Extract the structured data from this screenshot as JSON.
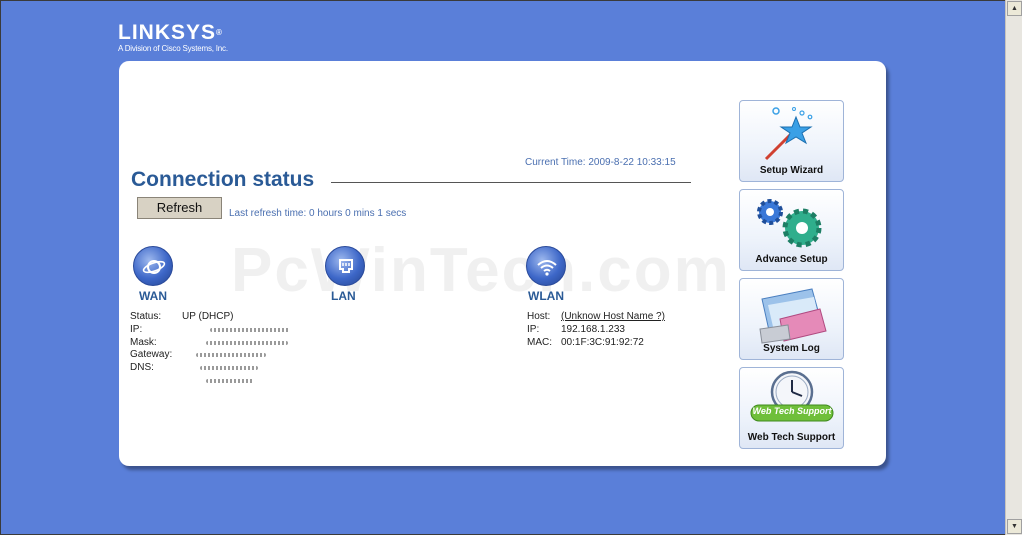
{
  "brand": {
    "name": "LINKSYS",
    "reg": "®",
    "subtitle": "A Division of Cisco Systems, Inc."
  },
  "header": {
    "current_time_label": "Current Time: 2009-8-22 10:33:15",
    "title": "Connection status"
  },
  "refresh": {
    "button_label": "Refresh",
    "last_refresh": "Last refresh time: 0 hours 0 mins 1 secs"
  },
  "watermark": "PcWinTech.com",
  "wan": {
    "label": "WAN",
    "fields": [
      {
        "key": "Status:",
        "value": "UP (DHCP)"
      },
      {
        "key": "IP:",
        "value": ""
      },
      {
        "key": "Mask:",
        "value": ""
      },
      {
        "key": "Gateway:",
        "value": ""
      },
      {
        "key": "DNS:",
        "value": ""
      }
    ]
  },
  "lan": {
    "label": "LAN"
  },
  "wlan": {
    "label": "WLAN",
    "fields": [
      {
        "key": "Host:",
        "value": "(Unknow Host Name ?)"
      },
      {
        "key": "IP:",
        "value": "192.168.1.233"
      },
      {
        "key": "MAC:",
        "value": "00:1F:3C:91:92:72"
      }
    ]
  },
  "sidebar": {
    "items": [
      {
        "label": "Setup Wizard",
        "icon": "wand-icon"
      },
      {
        "label": "Advance Setup",
        "icon": "gears-icon"
      },
      {
        "label": "System Log",
        "icon": "log-book-icon"
      },
      {
        "label": "Web Tech Support",
        "icon": "clock-icon",
        "badge": "Web Tech Support"
      }
    ]
  }
}
